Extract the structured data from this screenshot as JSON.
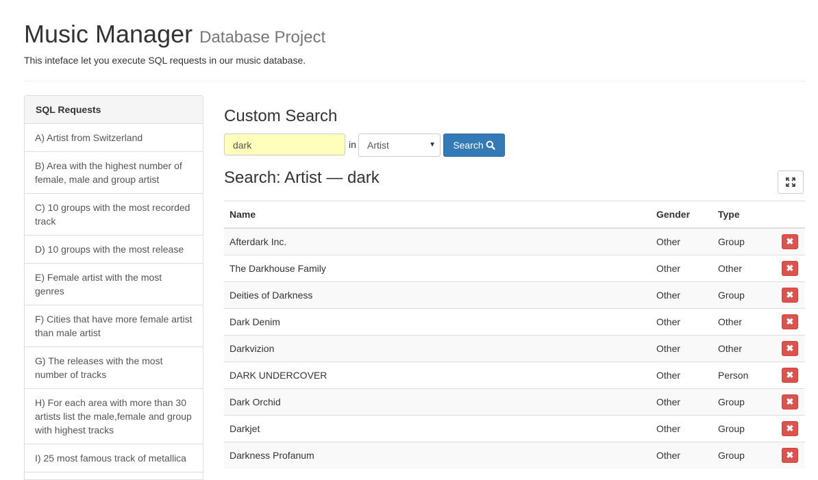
{
  "header": {
    "title": "Music Manager",
    "title_small": "Database Project",
    "subtitle": "This inteface let you execute SQL requests in our music database."
  },
  "sidebar": {
    "heading": "SQL Requests",
    "items": [
      {
        "label": "A) Artist from Switzerland"
      },
      {
        "label": "B) Area with the highest number of female, male and group artist"
      },
      {
        "label": "C) 10 groups with the most recorded track"
      },
      {
        "label": "D) 10 groups with the most release"
      },
      {
        "label": "E) Female artist with the most genres"
      },
      {
        "label": "F) Cities that have more female artist than male artist"
      },
      {
        "label": "G) The releases with the most number of tracks"
      },
      {
        "label": "H) For each area with more than 30 artists list the male,female and group with highest tracks"
      },
      {
        "label": "I) 25 most famous track of metallica"
      }
    ]
  },
  "search": {
    "heading": "Custom Search",
    "input_value": "dark",
    "in_label": "in",
    "selected_table": "Artist",
    "button_label": "Search"
  },
  "results": {
    "title": "Search: Artist — dark",
    "columns": [
      "Name",
      "Gender",
      "Type"
    ],
    "rows": [
      {
        "name": "Afterdark Inc.",
        "gender": "Other",
        "type": "Group"
      },
      {
        "name": "The Darkhouse Family",
        "gender": "Other",
        "type": "Other"
      },
      {
        "name": "Deities of Darkness",
        "gender": "Other",
        "type": "Group"
      },
      {
        "name": "Dark Denim",
        "gender": "Other",
        "type": "Other"
      },
      {
        "name": "Darkvizion",
        "gender": "Other",
        "type": "Other"
      },
      {
        "name": "DARK UNDERCOVER",
        "gender": "Other",
        "type": "Person"
      },
      {
        "name": "Dark Orchid",
        "gender": "Other",
        "type": "Group"
      },
      {
        "name": "Darkjet",
        "gender": "Other",
        "type": "Group"
      },
      {
        "name": "Darkness Profanum",
        "gender": "Other",
        "type": "Group"
      }
    ]
  },
  "colors": {
    "primary": "#337ab7",
    "danger": "#d9534f",
    "input_highlight": "#ffffbb"
  },
  "icons": {
    "search": "search-icon",
    "expand": "expand-icon",
    "delete": "times-icon"
  }
}
